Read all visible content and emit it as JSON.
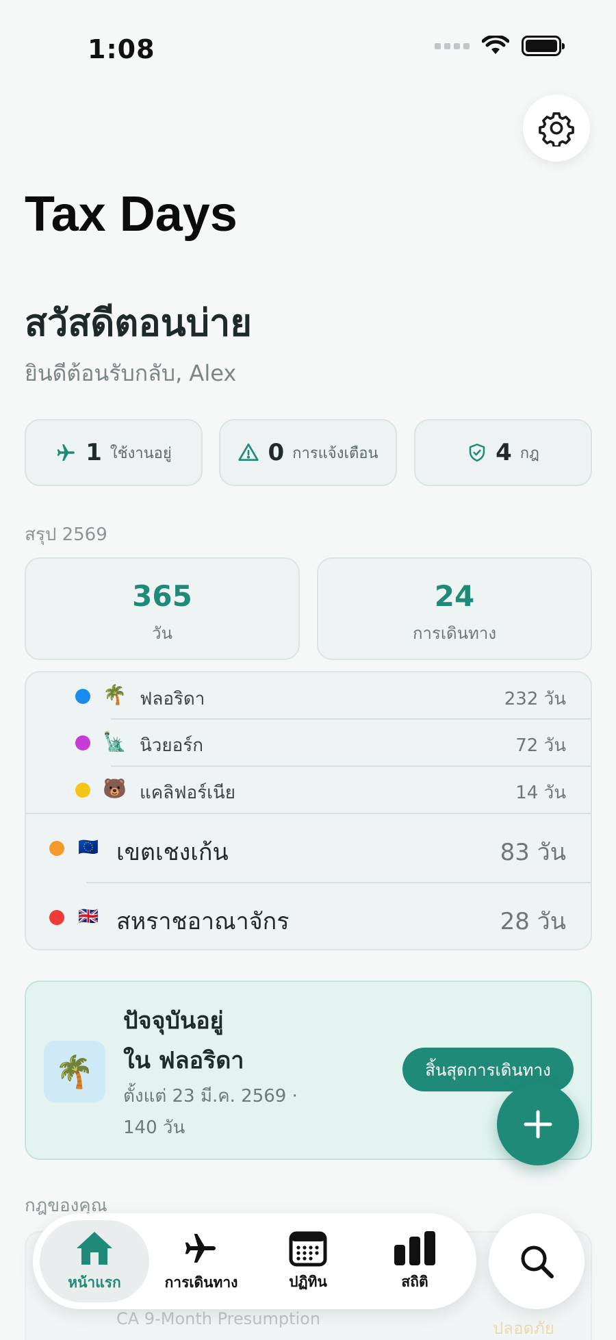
{
  "status_bar": {
    "time": "1:08"
  },
  "app": {
    "title": "Tax Days"
  },
  "greeting": {
    "headline": "สวัสดีตอนบ่าย",
    "welcome": "ยินดีต้อนรับกลับ, Alex"
  },
  "chips": [
    {
      "icon": "airplane-icon",
      "count": "1",
      "label": "ใช้งานอยู่"
    },
    {
      "icon": "warning-icon",
      "count": "0",
      "label": "การแจ้งเตือน"
    },
    {
      "icon": "shield-check-icon",
      "count": "4",
      "label": "กฎ"
    }
  ],
  "summary": {
    "label": "สรุป 2569",
    "days_value": "365",
    "days_label": "วัน",
    "trips_value": "24",
    "trips_label": "การเดินทาง"
  },
  "locations": [
    {
      "name": "ฟลอริดา",
      "emoji": "🌴",
      "dot_color": "#1a8cf0",
      "value": "232 วัน"
    },
    {
      "name": "นิวยอร์ก",
      "emoji": "🗽",
      "dot_color": "#c93bd6",
      "value": "72 วัน"
    },
    {
      "name": "แคลิฟอร์เนีย",
      "emoji": "🐻",
      "dot_color": "#f5c518",
      "value": "14 วัน"
    },
    {
      "name": "เขตเชงเก้น",
      "emoji": "🇪🇺",
      "dot_color": "#f39a2b",
      "value": "83 วัน"
    },
    {
      "name": "สหราชอาณาจักร",
      "emoji": "🇬🇧",
      "dot_color": "#ef3a3a",
      "value": "28 วัน"
    }
  ],
  "current": {
    "emoji": "🌴",
    "line1": "ปัจจุบันอยู่",
    "line2": "ใน ฟลอริดา",
    "since": "ตั้งแต่ 23 มี.ค. 2569 ·",
    "duration": "140 วัน",
    "end_button": "สิ้นสุดการเดินทาง"
  },
  "rules": {
    "label": "กฎของคุณ",
    "peek_subtitle": "CA 9-Month Presumption",
    "peek_status": "ปลอดภัย"
  },
  "tabs": [
    {
      "label": "หน้าแรก",
      "icon": "home-icon"
    },
    {
      "label": "การเดินทาง",
      "icon": "airplane-icon"
    },
    {
      "label": "ปฏิทิน",
      "icon": "calendar-icon"
    },
    {
      "label": "สถิติ",
      "icon": "bar-chart-icon"
    }
  ],
  "colors": {
    "accent": "#1f8a77",
    "background": "#f6f8f8"
  }
}
